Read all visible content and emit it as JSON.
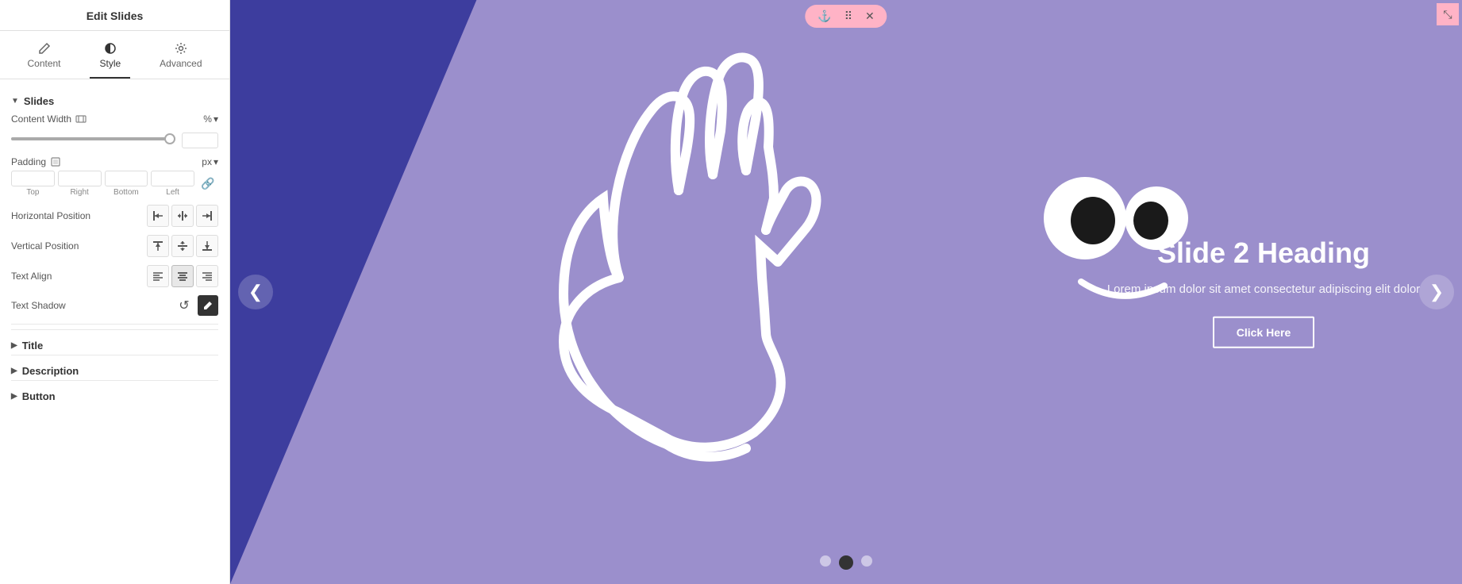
{
  "panel": {
    "header": "Edit Slides",
    "tabs": [
      {
        "id": "content",
        "label": "Content",
        "icon": "pencil"
      },
      {
        "id": "style",
        "label": "Style",
        "icon": "half-circle",
        "active": true
      },
      {
        "id": "advanced",
        "label": "Advanced",
        "icon": "gear"
      }
    ],
    "sections": {
      "slides": {
        "label": "Slides",
        "fields": {
          "content_width": {
            "label": "Content Width",
            "unit": "%",
            "value": "100"
          },
          "padding": {
            "label": "Padding",
            "unit": "px",
            "top": "",
            "right": "",
            "bottom": "",
            "left": "",
            "labels": [
              "Top",
              "Right",
              "Bottom",
              "Left"
            ]
          },
          "horizontal_position": {
            "label": "Horizontal Position"
          },
          "vertical_position": {
            "label": "Vertical Position"
          },
          "text_align": {
            "label": "Text Align"
          },
          "text_shadow": {
            "label": "Text Shadow"
          }
        }
      },
      "title": {
        "label": "Title"
      },
      "description": {
        "label": "Description"
      },
      "button": {
        "label": "Button"
      }
    }
  },
  "canvas": {
    "slide": {
      "heading": "Slide 2 Heading",
      "description": "Lorem ipsum dolor sit amet consectetur adipiscing elit dolor",
      "button_label": "Click Here",
      "dots": [
        "dot1",
        "dot2",
        "dot3"
      ],
      "active_dot": 1
    }
  },
  "icons": {
    "arrow_left": "❮",
    "arrow_right": "❯",
    "pencil": "✏",
    "gear": "⚙",
    "link": "🔗",
    "refresh": "↺",
    "edit_pen": "✏",
    "chevron_right": "▶",
    "move": "⠿",
    "close": "✕",
    "resize": "⤡"
  },
  "colors": {
    "accent": "#ffb3c6",
    "slide_bg_left": "#3d3d9e",
    "slide_bg_right": "#9b8fcc",
    "panel_bg": "#ffffff",
    "active_tab_border": "#333333"
  }
}
